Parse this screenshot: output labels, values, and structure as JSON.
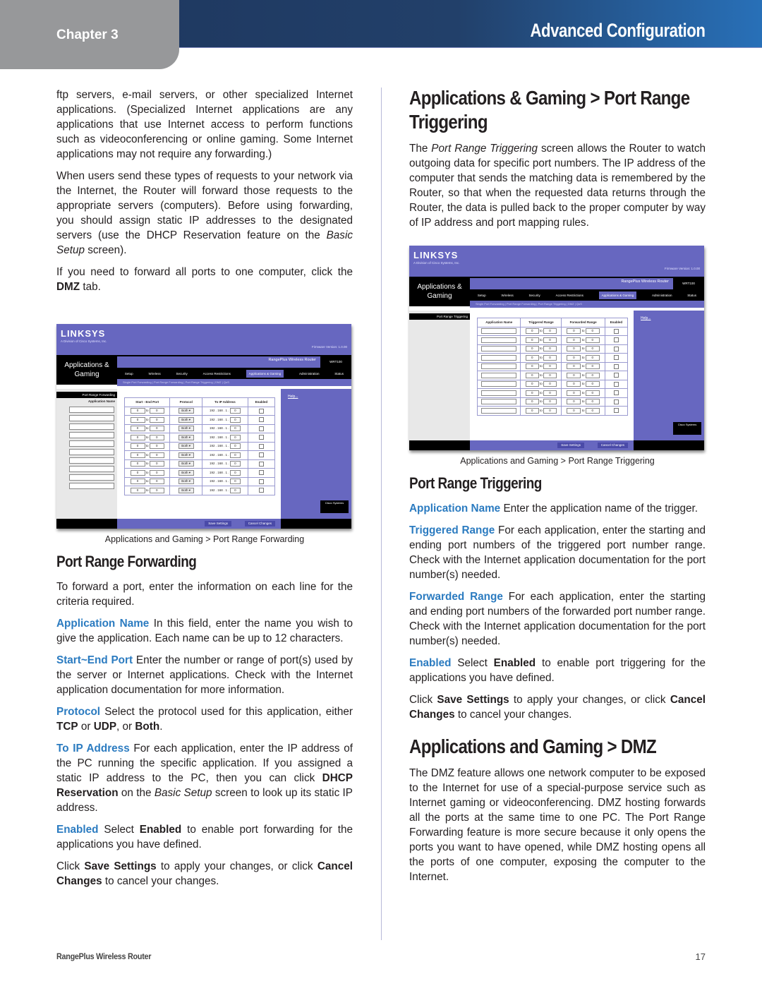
{
  "header": {
    "chapter": "Chapter 3",
    "title": "Advanced Configuration"
  },
  "left": {
    "p1": "ftp servers, e-mail servers, or other specialized Internet applications. (Specialized Internet applications are any applications that use Internet access to perform functions such as videoconferencing or online gaming. Some Internet applications may not require any forwarding.)",
    "p2_a": "When users send these types of requests to your network via the Internet, the Router will forward those requests to the appropriate servers (computers). Before using forwarding, you should assign static IP addresses to the designated servers (use the DHCP Reservation feature on the ",
    "p2_i": "Basic Setup",
    "p2_b": " screen).",
    "p3_a": "If you need to forward all ports to one computer, click the ",
    "p3_b": "DMZ",
    "p3_c": " tab.",
    "screenshot": {
      "logo": "LINKSYS",
      "logo_sub": "A Division of Cisco Systems, Inc.",
      "firmware": "Firmware Version: 1.0.00",
      "section": "Applications & Gaming",
      "product": "RangePlus Wireless Router",
      "model": "WRT100",
      "nav": [
        "Setup",
        "Wireless",
        "Security",
        "Access Restrictions",
        "Applications & Gaming",
        "Administration",
        "Status"
      ],
      "subnav": "Single Port Forwarding | Port Range Forwarding | Port Range Triggering | DMZ | QoS",
      "left_title": "Port Range Forwarding",
      "left_label": "Application Name",
      "columns": [
        "Start - End Port",
        "Protocol",
        "To IP Address",
        "Enabled"
      ],
      "row_start": "0",
      "row_to": "to",
      "row_end": "0",
      "row_protocol": "Both",
      "row_ip_prefix": "192 . 168 . 1 .",
      "row_ip_last": "0",
      "row_count": 10,
      "help": "Help...",
      "cisco": "Cisco Systems",
      "save": "Save Settings",
      "cancel": "Cancel Changes"
    },
    "caption": "Applications and Gaming > Port Range Forwarding",
    "h2": "Port Range Forwarding",
    "intro": "To forward a port, enter the information on each line for the criteria required.",
    "appname_kw": "Application Name",
    "appname_txt": " In this field, enter the name you wish to give the application. Each name can be up to 12 characters.",
    "startend_kw": "Start~End Port",
    "startend_txt": " Enter the number or range of port(s) used by the server or Internet applications. Check with the Internet application documentation for more information.",
    "protocol_kw": "Protocol",
    "protocol_a": "  Select the protocol used for this application, either ",
    "protocol_tcp": "TCP",
    "protocol_or": " or ",
    "protocol_udp": "UDP",
    "protocol_or2": ", or ",
    "protocol_both": "Both",
    "protocol_end": ".",
    "toip_kw": "To IP Address",
    "toip_a": "  For each application, enter the IP address of the PC running the specific application. If you assigned a static IP address to the PC, then you can click ",
    "toip_b": "DHCP Reservation",
    "toip_c": " on the ",
    "toip_i": "Basic Setup",
    "toip_d": " screen to look up its static IP address.",
    "enabled_kw": "Enabled",
    "enabled_a": "  Select ",
    "enabled_b": "Enabled",
    "enabled_c": " to enable port forwarding for the applications you have defined.",
    "click_a": "Click ",
    "click_save": "Save Settings",
    "click_b": " to apply your changes, or click ",
    "click_cancel": "Cancel Changes",
    "click_c": " to cancel your changes."
  },
  "right": {
    "h1": "Applications & Gaming > Port Range Triggering",
    "p1_a": "The ",
    "p1_i": "Port Range Triggering",
    "p1_b": " screen allows the Router to watch outgoing data for specific port numbers. The IP address of the computer that sends the matching data is remembered by the Router, so that when the requested data returns through the Router, the data is pulled back to the proper computer by way of IP address and port mapping rules.",
    "screenshot": {
      "logo": "LINKSYS",
      "logo_sub": "A Division of Cisco Systems, Inc.",
      "firmware": "Firmware Version: 1.0.00",
      "section": "Applications & Gaming",
      "product": "RangePlus Wireless Router",
      "model": "WRT100",
      "nav": [
        "Setup",
        "Wireless",
        "Security",
        "Access Restrictions",
        "Applications & Gaming",
        "Administration",
        "Status"
      ],
      "subnav": "Single Port Forwarding | Port Range Forwarding | Port Range Triggering | DMZ | QoS",
      "left_title": "Port Range Triggering",
      "columns": [
        "Application Name",
        "Triggered Range",
        "Forwarded Range",
        "Enabled"
      ],
      "row_start": "0",
      "row_to": "to",
      "row_end": "0",
      "row_count": 10,
      "help": "Help...",
      "cisco": "Cisco Systems",
      "save": "Save Settings",
      "cancel": "Cancel Changes"
    },
    "caption": "Applications and Gaming > Port Range Triggering",
    "h2": "Port Range Triggering",
    "appname_kw": "Application Name",
    "appname_txt": " Enter the application name of the trigger.",
    "trig_kw": "Triggered Range",
    "trig_txt": "  For each application, enter the starting and ending port numbers of the triggered port number range. Check with the Internet application documentation for the port number(s) needed.",
    "fwd_kw": "Forwarded Range",
    "fwd_txt": "  For each application, enter the starting and ending port numbers of the forwarded port number range. Check with the Internet application documentation for the port number(s) needed.",
    "enabled_kw": "Enabled",
    "enabled_a": "  Select ",
    "enabled_b": "Enabled",
    "enabled_c": " to enable port triggering for the applications you have defined.",
    "click_a": "Click ",
    "click_save": "Save Settings",
    "click_b": " to apply your changes, or click ",
    "click_cancel": "Cancel Changes",
    "click_c": " to cancel your changes.",
    "dmz_h1": "Applications and Gaming > DMZ",
    "dmz_p": "The DMZ feature allows one network computer to be exposed to the Internet for use of a special-purpose service such as Internet gaming or videoconferencing. DMZ hosting forwards all the ports at the same time to one PC. The Port Range Forwarding feature is more secure because it only opens the ports you want to have opened, while DMZ hosting opens all the ports of one computer, exposing the computer to the Internet."
  },
  "footer": {
    "product": "RangePlus Wireless Router",
    "page": "17"
  }
}
